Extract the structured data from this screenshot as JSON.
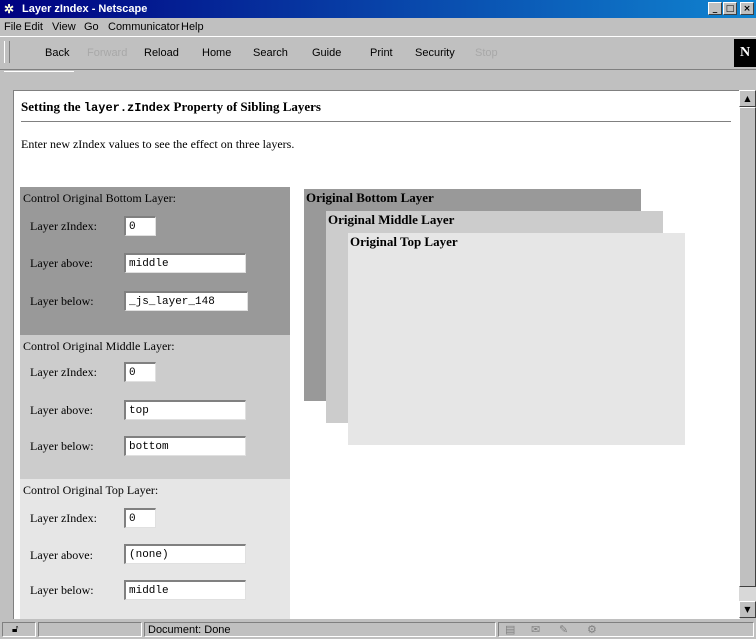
{
  "window": {
    "title": "Layer zIndex - Netscape"
  },
  "menu": [
    "File",
    "Edit",
    "View",
    "Go",
    "Communicator",
    "Help"
  ],
  "toolbar": {
    "back": "Back",
    "forward": "Forward",
    "reload": "Reload",
    "home": "Home",
    "search": "Search",
    "guide": "Guide",
    "print": "Print",
    "security": "Security",
    "stop": "Stop",
    "logo": "N"
  },
  "page": {
    "title_prefix": "Setting the ",
    "title_code": "layer.zIndex",
    "title_suffix": " Property of Sibling Layers",
    "intro": "Enter new zIndex values to see the effect on three layers."
  },
  "labels": {
    "zindex": "Layer zIndex:",
    "above": "Layer above:",
    "below": "Layer below:"
  },
  "controls": {
    "bottom": {
      "title": "Control Original Bottom Layer:",
      "zindex": "0",
      "above": "middle",
      "below": "_js_layer_148",
      "color": "#999999"
    },
    "middle": {
      "title": "Control Original Middle Layer:",
      "zindex": "0",
      "above": "top",
      "below": "bottom",
      "color": "#cccccc"
    },
    "top": {
      "title": "Control Original Top Layer:",
      "zindex": "0",
      "above": "(none)",
      "below": "middle",
      "color": "#e6e6e6"
    }
  },
  "layers": {
    "bottom": {
      "label": "Original Bottom Layer",
      "color": "#999999"
    },
    "middle": {
      "label": "Original Middle Layer",
      "color": "#cccccc"
    },
    "top": {
      "label": "Original Top Layer",
      "color": "#e6e6e6"
    }
  },
  "status": {
    "text": "Document: Done"
  }
}
